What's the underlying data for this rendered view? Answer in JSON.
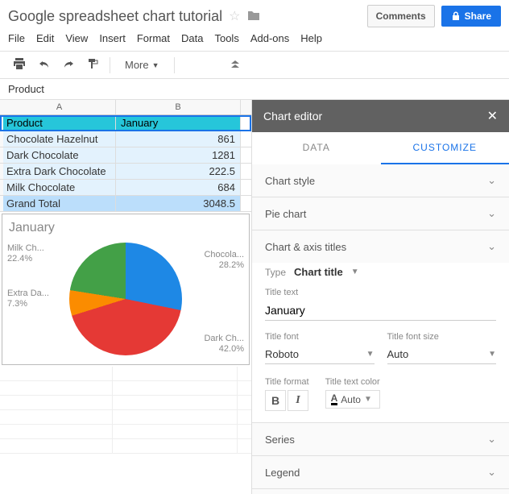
{
  "doc_title": "Google spreadsheet chart tutorial",
  "buttons": {
    "comments": "Comments",
    "share": "Share"
  },
  "menubar": [
    "File",
    "Edit",
    "View",
    "Insert",
    "Format",
    "Data",
    "Tools",
    "Add-ons",
    "Help"
  ],
  "toolbar": {
    "more": "More"
  },
  "namebox": "Product",
  "columns": [
    "A",
    "B"
  ],
  "table": {
    "header": {
      "a": "Product",
      "b": "January"
    },
    "rows": [
      {
        "a": "Chocolate Hazelnut",
        "b": "861"
      },
      {
        "a": "Dark Chocolate",
        "b": "1281"
      },
      {
        "a": "Extra Dark Chocolate",
        "b": "222.5"
      },
      {
        "a": "Milk Chocolate",
        "b": "684"
      }
    ],
    "total": {
      "a": "Grand Total",
      "b": "3048.5"
    }
  },
  "chart_data": {
    "type": "pie",
    "title": "January",
    "categories": [
      "Chocolate Hazelnut",
      "Dark Chocolate",
      "Extra Dark Chocolate",
      "Milk Chocolate"
    ],
    "values": [
      861,
      1281,
      222.5,
      684
    ],
    "percents": [
      28.2,
      42.0,
      7.3,
      22.4
    ],
    "labels": {
      "choc": "Chocola...",
      "choc_pct": "28.2%",
      "dark": "Dark Ch...",
      "dark_pct": "42.0%",
      "extra": "Extra Da...",
      "extra_pct": "7.3%",
      "milk": "Milk Ch...",
      "milk_pct": "22.4%"
    }
  },
  "editor": {
    "title": "Chart editor",
    "tabs": {
      "data": "DATA",
      "customize": "CUSTOMIZE"
    },
    "sections": {
      "chart_style": "Chart style",
      "pie_chart": "Pie chart",
      "axis_titles": "Chart & axis titles",
      "series": "Series",
      "legend": "Legend"
    },
    "axis": {
      "type_label": "Type",
      "type_value": "Chart title",
      "title_text_label": "Title text",
      "title_text_value": "January",
      "title_font_label": "Title font",
      "title_font_value": "Roboto",
      "title_size_label": "Title font size",
      "title_size_value": "Auto",
      "title_format_label": "Title format",
      "title_color_label": "Title text color",
      "title_color_value": "Auto"
    }
  }
}
